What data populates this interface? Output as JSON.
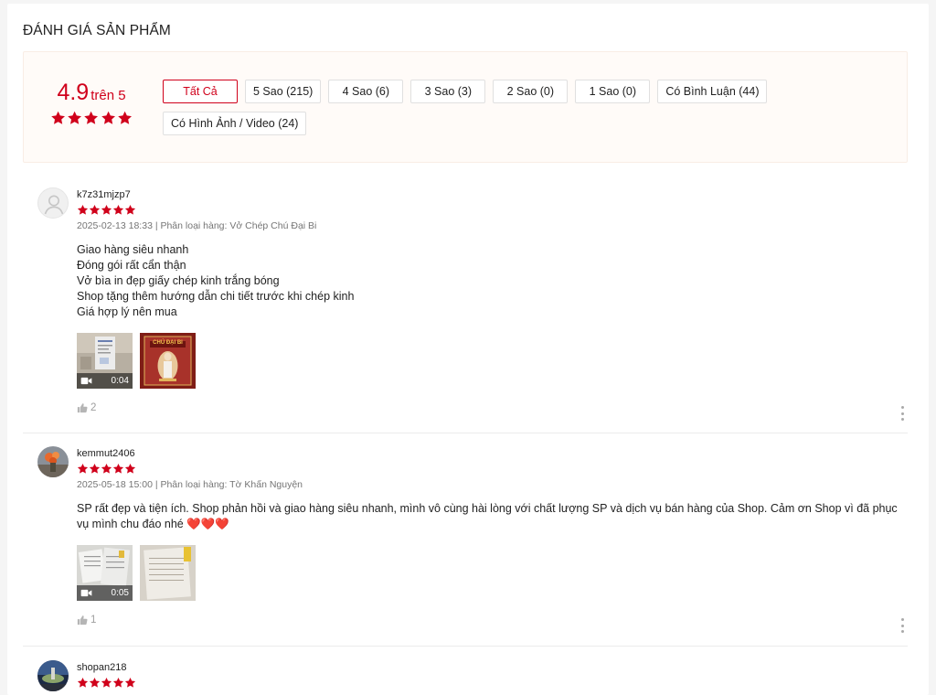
{
  "section_title": "ĐÁNH GIÁ SẢN PHẨM",
  "colors": {
    "accent": "#d0011b",
    "muted": "#757575",
    "summary_bg": "#fffbf8"
  },
  "summary": {
    "score": "4.9",
    "score_suffix": "trên 5",
    "rating": 5,
    "filters": [
      {
        "label": "Tất Cả",
        "active": true
      },
      {
        "label": "5 Sao (215)"
      },
      {
        "label": "4 Sao (6)"
      },
      {
        "label": "3 Sao (3)"
      },
      {
        "label": "2 Sao (0)"
      },
      {
        "label": "1 Sao (0)"
      },
      {
        "label": "Có Bình Luận (44)"
      },
      {
        "label": "Có Hình Ảnh / Video (24)"
      }
    ]
  },
  "reviews": [
    {
      "username": "k7z31mjzp7",
      "rating": 5,
      "meta": "2025-02-13 18:33 | Phân loại hàng: Vở Chép Chú Đại Bi",
      "content": "Giao hàng siêu nhanh\nĐóng gói rất cẩn thận\nVở bìa in đẹp giấy chép kinh trắng bóng\nShop tặng thêm hướng dẫn chi tiết trước khi chép kinh\nGiá hợp lý nên mua",
      "video_duration": "0:04",
      "likes": "2",
      "image_caption": "CHÚ ĐẠI BI"
    },
    {
      "username": "kemmut2406",
      "rating": 5,
      "meta": "2025-05-18 15:00 | Phân loại hàng: Tờ Khấn Nguyện",
      "content": "SP rất đẹp và tiện ích. Shop phản hồi và giao hàng siêu nhanh, mình vô cùng hài lòng với chất lượng SP và dịch vụ bán hàng của Shop. Cảm ơn Shop vì đã phục vụ mình chu đáo nhé ❤️❤️❤️",
      "video_duration": "0:05",
      "likes": "1"
    },
    {
      "username": "shopan218",
      "rating": 5
    }
  ]
}
